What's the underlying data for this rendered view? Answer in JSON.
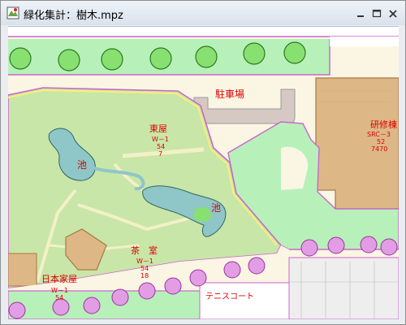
{
  "window": {
    "title": "緑化集計：樹木.mpz",
    "icons": {
      "app": "map-app-icon",
      "minimize": "minimize-icon",
      "maximize": "maximize-icon",
      "close": "close-icon"
    }
  },
  "map": {
    "colors": {
      "paved": "#fbf5e4",
      "lawn": "#c8e6a7",
      "green_area": "#b7f1b9",
      "building": "#ddb886",
      "pond": "#8fc6c7",
      "road_edge": "#cc66cc",
      "tree_green": "#88e070",
      "tree_pink": "#e29de5",
      "label": "#dd0000"
    },
    "labels": {
      "parking": "駐車場",
      "east_house": {
        "name": "東屋",
        "code": "W－1",
        "n1": "54",
        "n2": "7"
      },
      "pond1": "池",
      "pond2": "池",
      "tea_house": {
        "name": "茶　室",
        "code": "W－1",
        "n1": "54",
        "n2": "18"
      },
      "japanese_house": {
        "name": "日本家屋",
        "code": "W－1",
        "n1": "54"
      },
      "training": {
        "name": "研修棟",
        "code": "SRC－3",
        "n1": "52",
        "n2": "7470"
      },
      "tennis": "テニスコート"
    }
  }
}
